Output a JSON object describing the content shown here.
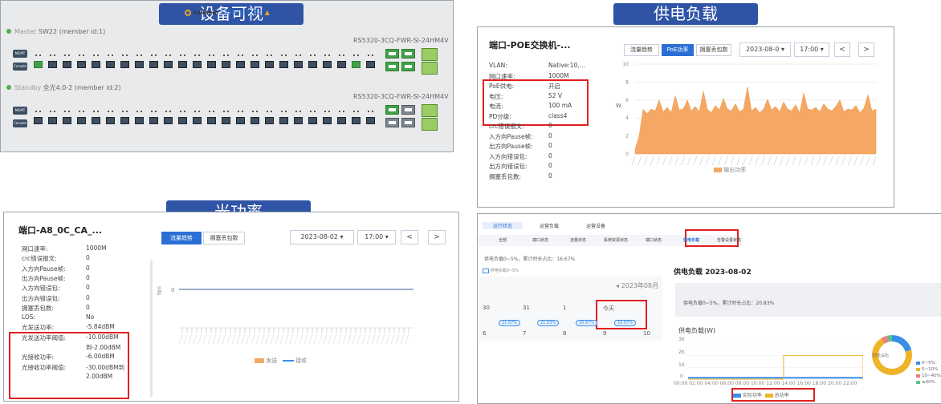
{
  "banners": {
    "device_visual": "设备可视",
    "power_supply": "供电负载",
    "optical_power": "光功率"
  },
  "switch": {
    "logo_text": "SUNDRAY",
    "name": "SW22全光4.0",
    "master_label": "Master",
    "master_name": "SW22 (member id:1)",
    "master_model": "RS5320-3CQ-FWR-SI-24HM4V",
    "standby_label": "Standby",
    "standby_name": "全光4.0-2 (member id:2)",
    "standby_model": "RS5320-3CQ-FWR-SI-24HM4V",
    "console_label": "Console",
    "mgmt_label": "MGMT",
    "port_numbers": [
      "1",
      "2",
      "3",
      "4",
      "5",
      "6",
      "7",
      "8",
      "9",
      "10",
      "11",
      "12",
      "13",
      "14",
      "15",
      "16",
      "17",
      "18",
      "19",
      "20",
      "21",
      "22",
      "23",
      "24"
    ],
    "uplink_a": [
      "25",
      "26"
    ],
    "uplink_b": [
      "27",
      "28"
    ],
    "uplink_c": [
      "29",
      "30",
      "31"
    ]
  },
  "poe_panel": {
    "title": "端口-POE交换机-...",
    "rows": [
      {
        "k": "VLAN:",
        "v": "Native:10,..."
      },
      {
        "k": "网口速率:",
        "v": "1000M"
      },
      {
        "k": "PoE供电:",
        "v": "开启"
      },
      {
        "k": "电压:",
        "v": "52 V"
      },
      {
        "k": "电流:",
        "v": "100 mA"
      },
      {
        "k": "PD分级:",
        "v": "class4"
      },
      {
        "k": "crc错误报文:",
        "v": "0"
      },
      {
        "k": "入方向Pause帧:",
        "v": "0"
      },
      {
        "k": "出方向Pause帧:",
        "v": "0"
      },
      {
        "k": "入方向错误包:",
        "v": "0"
      },
      {
        "k": "出方向错误包:",
        "v": "0"
      },
      {
        "k": "拥塞丢包数:",
        "v": "0"
      }
    ],
    "tabs": [
      "流量趋势",
      "PoE功率",
      "拥塞丢包数"
    ],
    "date": "2023-08-0",
    "time": "17:00",
    "prev": "<",
    "next": ">",
    "ylabel": "W",
    "yticks": [
      "10",
      "8",
      "6",
      "4",
      "2",
      "0"
    ],
    "legend": "输出功率"
  },
  "optical_panel": {
    "title": "端口-A8_0C_CA_...",
    "rows": [
      {
        "k": "网口速率:",
        "v": "1000M"
      },
      {
        "k": "crc错误报文:",
        "v": "0"
      },
      {
        "k": "入方向Pause帧:",
        "v": "0"
      },
      {
        "k": "出方向Pause帧:",
        "v": "0"
      },
      {
        "k": "入方向错误包:",
        "v": "0"
      },
      {
        "k": "出方向错误包:",
        "v": "0"
      },
      {
        "k": "拥塞丢包数:",
        "v": "0"
      },
      {
        "k": "LOS:",
        "v": "No"
      },
      {
        "k": "光发送功率:",
        "v": "-5.84dBM"
      },
      {
        "k": "光发送功率阈值:",
        "v": "-10.00dBM"
      },
      {
        "k": "",
        "v": "到-2.00dBM"
      },
      {
        "k": "光接收功率:",
        "v": "-6.00dBM"
      },
      {
        "k": "光接收功率阈值:",
        "v": "-30.00dBM到"
      },
      {
        "k": "",
        "v": "2.00dBM"
      }
    ],
    "tabs": [
      "流量趋势",
      "拥塞丢包数"
    ],
    "date": "2023-08-02",
    "time": "17:00",
    "prev": "<",
    "next": ">",
    "ylabel": "bps",
    "ytick": "0",
    "legend_send": "发送",
    "legend_recv": "接收"
  },
  "load_panel": {
    "tabs_top": [
      "运行状态",
      "运营负载",
      "运营设备"
    ],
    "filters": [
      "全部",
      "端口状态",
      "流量状态",
      "系统资源状态",
      "端口状态",
      "供电负载",
      "告警设置状态"
    ],
    "stat_text": "供电负载0~5%，累计时长占比：16.67%",
    "checkbox_label": "供电负载0~5%",
    "calendar_title": "2023年08月",
    "calendar_days": [
      "30",
      "31",
      "1",
      "今天",
      "",
      "6",
      "7",
      "8",
      "9",
      "10"
    ],
    "calendar_badges": [
      "21.67%",
      "21.63%",
      "16.67%",
      "16.67%"
    ],
    "detail_title": "供电负载 2023-08-02",
    "detail_stat": "供电负载0~5%，累计时长占比：20.83%",
    "chart_label": "供电负载(W)",
    "yticks": [
      "3K",
      "2K",
      "1K",
      "0"
    ],
    "xaxis_text": "00:00 02:00 04:00 06:00 08:00 10:00 12:00 14:00 16:00 18:00 20:00 22:00",
    "legend_actual": "实际功率",
    "legend_total": "总功率",
    "donut_label": "时长占比",
    "donut_legend": [
      "0~5%",
      "5~10%",
      "10~40%",
      "≥40%"
    ],
    "colors": {
      "c1": "#3a8ee6",
      "c2": "#f0b429",
      "c3": "#f07b7b",
      "c4": "#61c18c"
    }
  },
  "chart_data": [
    {
      "type": "area",
      "title": "",
      "ylabel": "W",
      "ylim": [
        0,
        10
      ],
      "series": [
        {
          "name": "输出功率",
          "values": [
            0.5,
            2,
            5,
            4.5,
            5,
            4.8,
            6,
            4.7,
            5.2,
            4.6,
            6.5,
            4.9,
            5,
            6,
            4.8,
            5.3,
            4.7,
            7,
            5,
            4.6,
            5.4,
            4.9,
            6.2,
            5,
            4.8,
            5.6,
            4.7,
            5,
            7.5,
            4.8,
            5.2,
            4.6,
            5,
            6.1,
            4.9,
            5.3,
            4.7,
            5.8,
            5,
            4.8,
            5.5,
            4.6,
            6.8,
            5,
            4.9,
            5.2,
            4.7,
            5.6,
            5,
            4.8,
            5.3,
            6,
            4.7,
            5,
            4.9,
            5.4,
            4.6,
            5.1,
            6.6,
            4.8,
            5
          ]
        }
      ]
    },
    {
      "type": "line",
      "title": "供电负载(W)",
      "ylabel": "",
      "ylim": [
        0,
        3000
      ],
      "series": [
        {
          "name": "实际功率",
          "values": [
            120,
            120,
            120,
            120,
            120,
            120,
            120,
            120,
            120,
            120,
            120,
            120
          ]
        },
        {
          "name": "总功率",
          "values": [
            0,
            0,
            0,
            0,
            0,
            0,
            2000,
            2000,
            2000,
            2000,
            2000,
            0
          ]
        }
      ]
    },
    {
      "type": "pie",
      "title": "时长占比",
      "categories": [
        "0~5%",
        "5~10%",
        "10~40%",
        "≥40%"
      ],
      "values": [
        20.83,
        70,
        5,
        4.17
      ]
    }
  ]
}
